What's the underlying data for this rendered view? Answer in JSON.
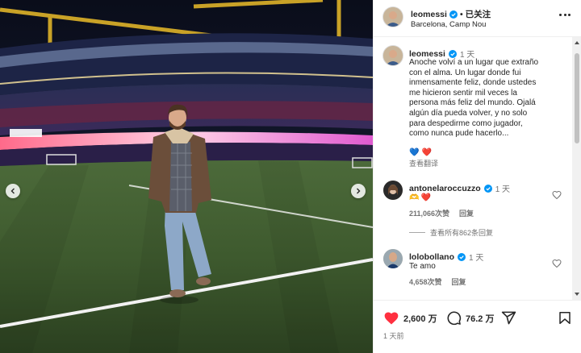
{
  "post": {
    "username": "leomessi",
    "follow_state": "已关注",
    "location": "Barcelona, Camp Nou",
    "separator": "•"
  },
  "caption": {
    "username": "leomessi",
    "time": "1 天",
    "text": "Anoche volví a un lugar que extraño\ncon el alma. Un lugar donde fui\ninmensamente feliz, donde ustedes\nme hicieron sentir mil veces la\npersona más feliz del mundo. Ojalá\nalgún día pueda volver, y no solo\npara despedirme como jugador,\ncomo nunca pude hacerlo...",
    "emoji": [
      "💙",
      "❤️"
    ],
    "translate_label": "查看翻译"
  },
  "comments": [
    {
      "username": "antonelaroccuzzo",
      "time": "1 天",
      "text_prefix": "🫶",
      "text": "❤️",
      "likes": "211,066次赞",
      "reply_label": "回复",
      "view_replies": "查看所有862条回复"
    },
    {
      "username": "lolobollano",
      "time": "1 天",
      "text": "Te amo",
      "likes": "4,658次赞",
      "reply_label": "回复"
    }
  ],
  "actions": {
    "likes": "2,600 万",
    "comments": "76.2 万",
    "date": "1 天前"
  },
  "icons": {
    "verified": "verified-badge-icon",
    "more": "more-options-icon",
    "heart": "heart-icon",
    "comment": "comment-icon",
    "share": "share-icon",
    "save": "bookmark-icon",
    "prev": "chevron-left-icon",
    "next": "chevron-right-icon"
  },
  "colors": {
    "like_red": "#ff3040",
    "verified_blue": "#0095f6",
    "text": "#262626",
    "muted": "#737373"
  }
}
